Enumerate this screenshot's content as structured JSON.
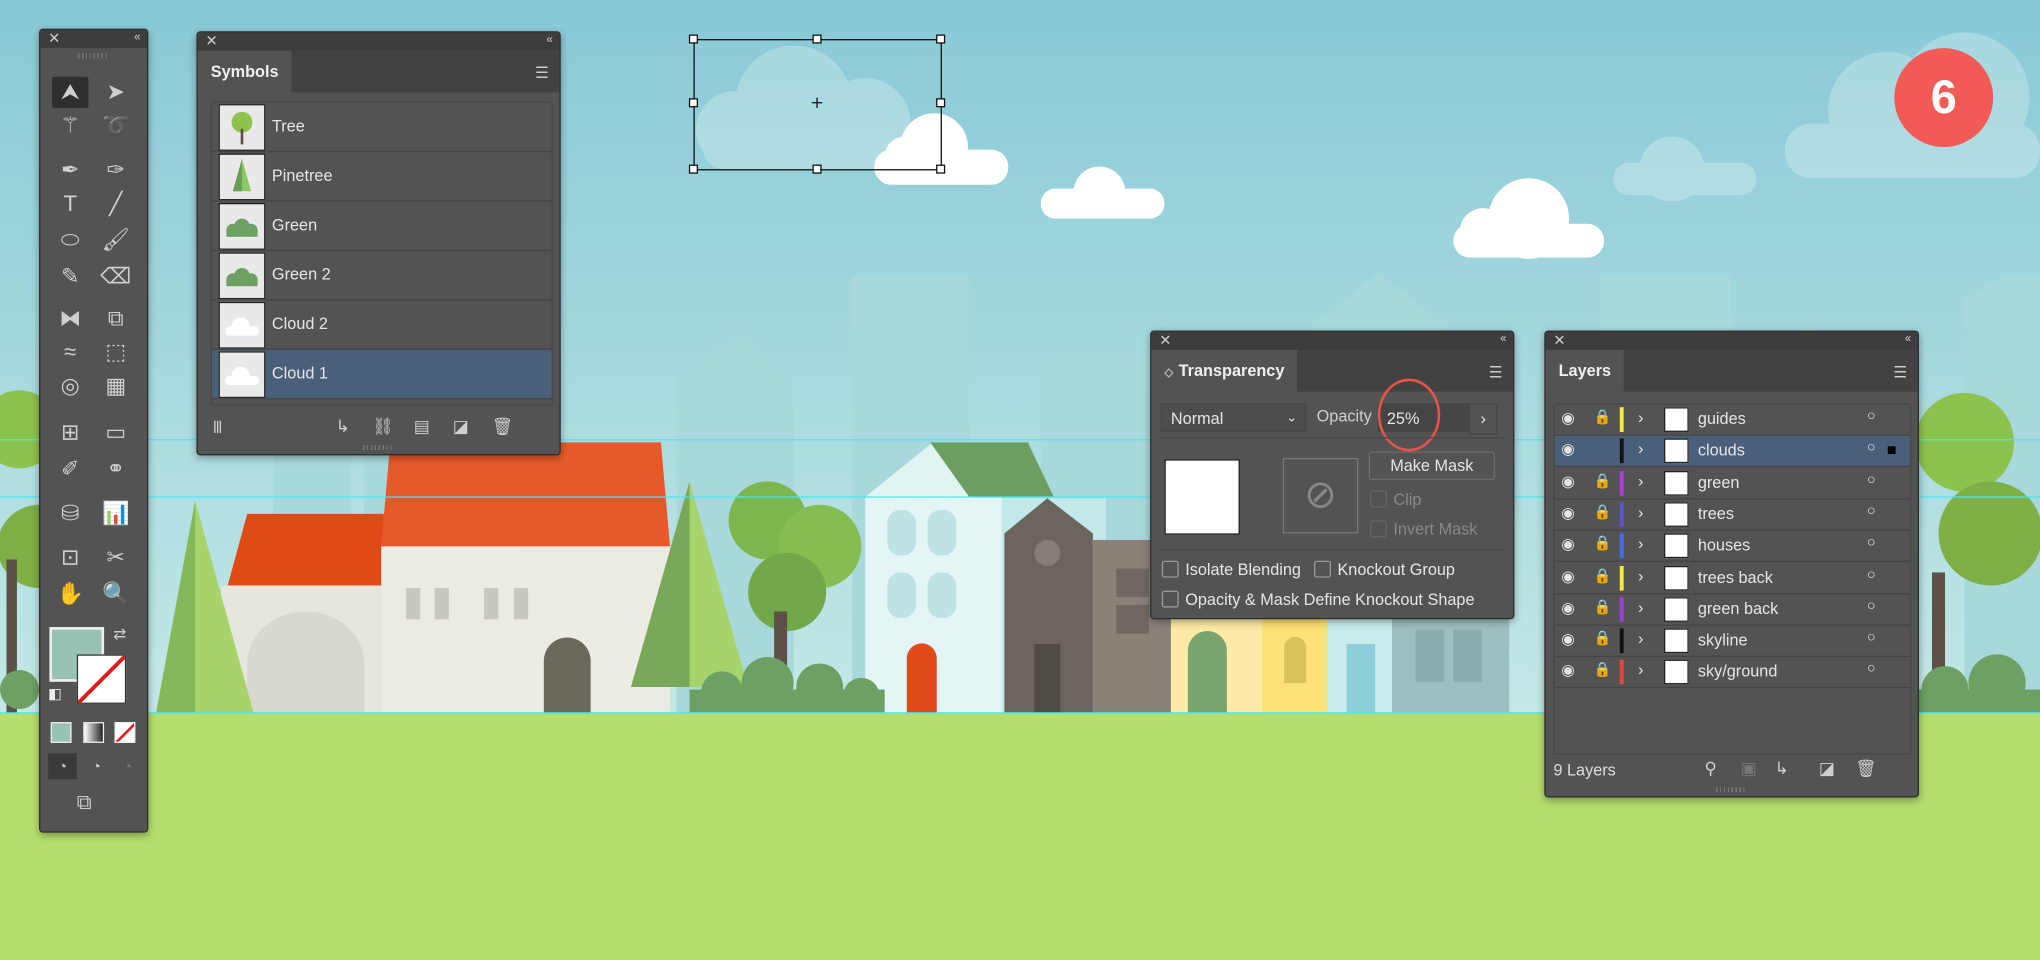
{
  "badge": {
    "number": "6",
    "color": "#f25b55"
  },
  "toolbar": {
    "tools": [
      "selection-tool",
      "direct-selection-tool",
      "magic-wand-tool",
      "lasso-tool",
      "pen-tool",
      "curvature-tool",
      "type-tool",
      "line-segment-tool",
      "ellipse-tool",
      "paintbrush-tool",
      "shaper-tool",
      "eraser-tool",
      "reflect-tool",
      "scale-tool",
      "width-tool",
      "free-transform-tool",
      "shape-builder-tool",
      "perspective-grid-tool",
      "mesh-tool",
      "gradient-tool",
      "eyedropper-tool",
      "blend-tool",
      "symbol-sprayer-tool",
      "column-graph-tool",
      "artboard-tool",
      "slice-tool",
      "hand-tool",
      "zoom-tool"
    ],
    "fill_color": "#97c3b3"
  },
  "symbols": {
    "title": "Symbols",
    "items": [
      {
        "label": "Tree",
        "icon": "tree-icon"
      },
      {
        "label": "Pinetree",
        "icon": "pinetree-icon"
      },
      {
        "label": "Green",
        "icon": "bush-icon"
      },
      {
        "label": "Green 2",
        "icon": "bush-icon"
      },
      {
        "label": "Cloud 2",
        "icon": "cloud-icon"
      },
      {
        "label": "Cloud 1",
        "icon": "cloud-icon",
        "selected": true
      }
    ]
  },
  "transparency": {
    "title": "Transparency",
    "blend_mode": "Normal",
    "opacity_label": "Opacity",
    "opacity_value": "25%",
    "make_mask": "Make Mask",
    "clip": "Clip",
    "invert_mask": "Invert Mask",
    "isolate_blending": "Isolate Blending",
    "knockout_group": "Knockout Group",
    "knockout_shape": "Opacity & Mask Define Knockout Shape",
    "highlight_color": "#e8534a"
  },
  "layers": {
    "title": "Layers",
    "count_label": "9 Layers",
    "items": [
      {
        "name": "guides",
        "color": "#f5e93a",
        "locked": true
      },
      {
        "name": "clouds",
        "color": "#111111",
        "locked": false,
        "selected": true
      },
      {
        "name": "green",
        "color": "#b13be0",
        "locked": true
      },
      {
        "name": "trees",
        "color": "#5a55d6",
        "locked": true
      },
      {
        "name": "houses",
        "color": "#3f6ff0",
        "locked": true
      },
      {
        "name": "trees back",
        "color": "#f5e93a",
        "locked": true
      },
      {
        "name": "green back",
        "color": "#a23ed8",
        "locked": true
      },
      {
        "name": "skyline",
        "color": "#111111",
        "locked": true
      },
      {
        "name": "sky/ground",
        "color": "#e8443a",
        "locked": true
      }
    ]
  }
}
